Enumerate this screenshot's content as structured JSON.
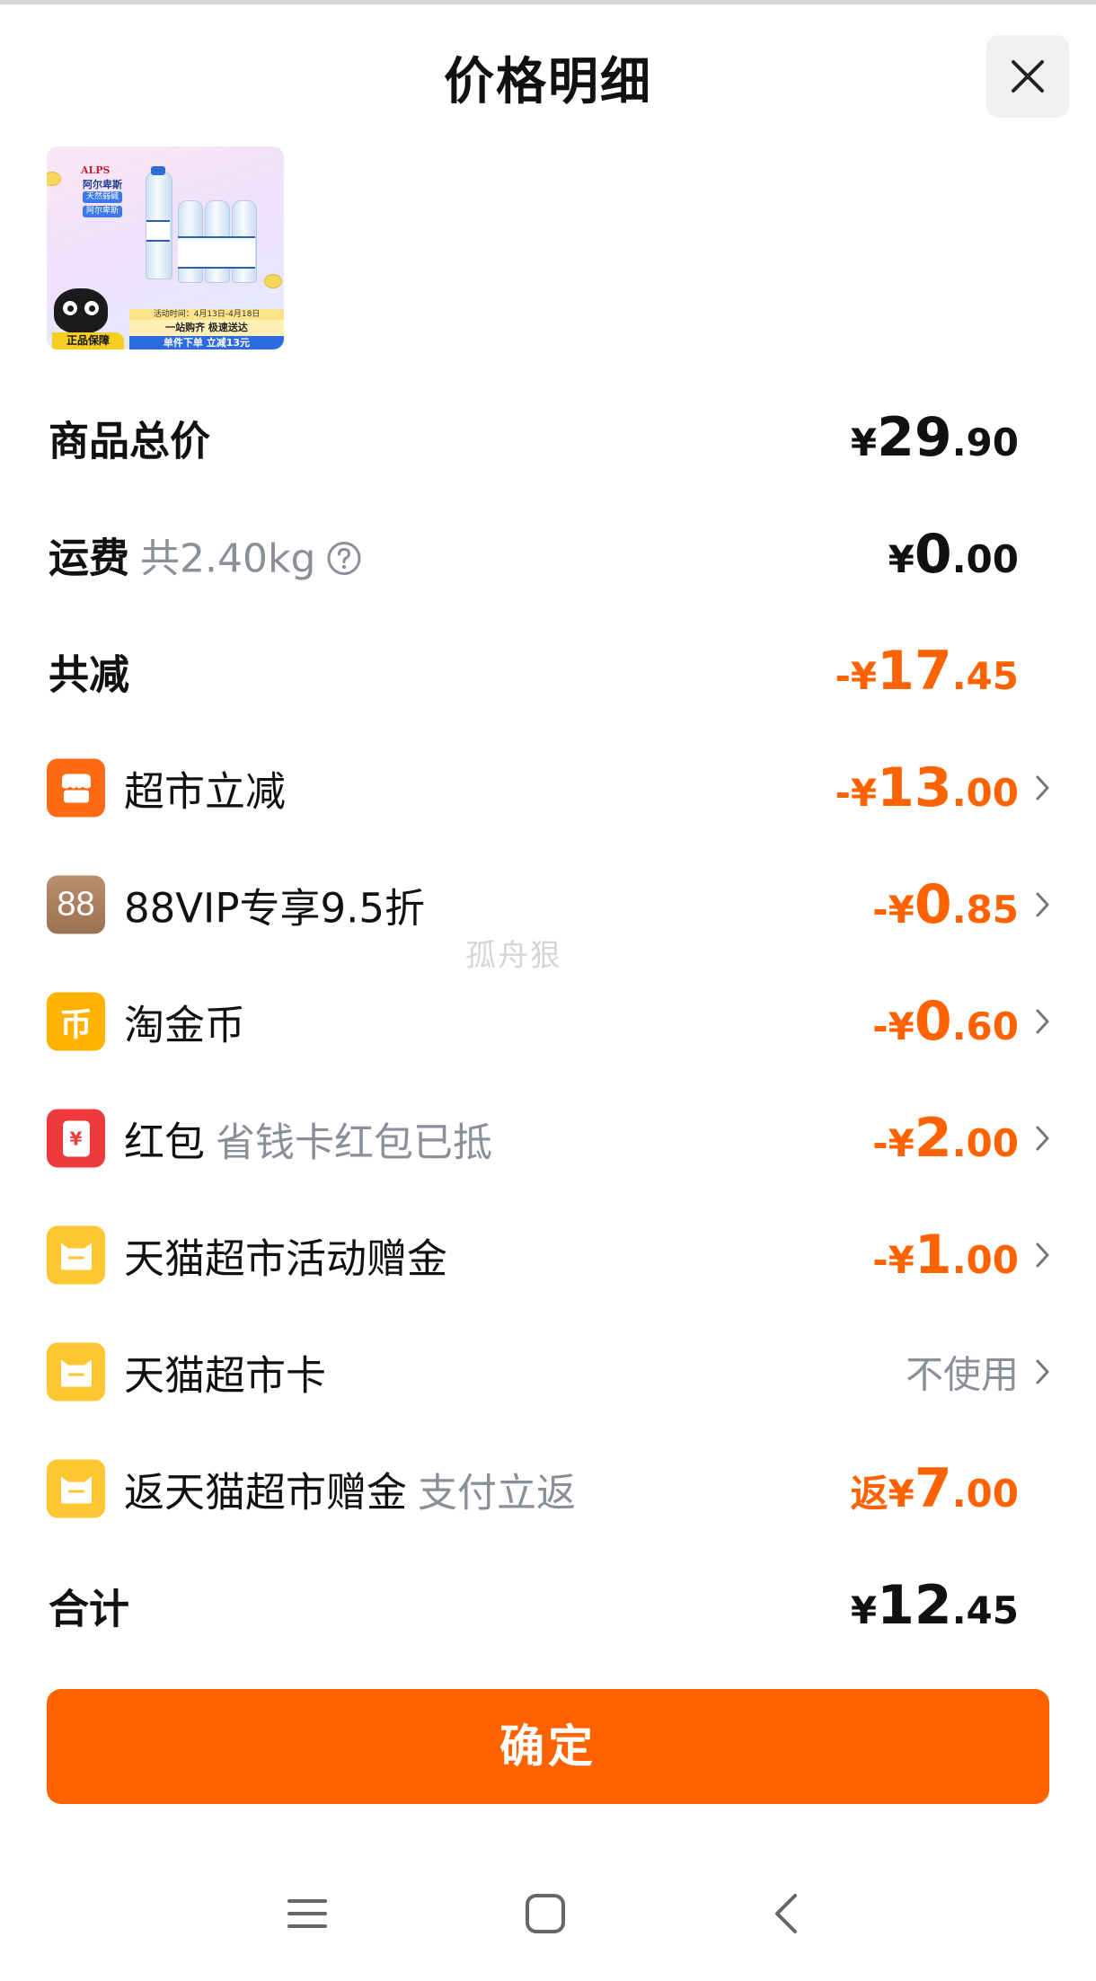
{
  "header": {
    "title": "价格明细"
  },
  "product": {
    "brand_latin": "ALPS",
    "brand_cn": "阿尔卑斯",
    "tags": [
      "天然弱碱",
      "阿尔卑斯"
    ],
    "promo_line1": "活动时间：4月13日-4月18日",
    "promo_line2": "一站购齐 极速送达",
    "promo_line3": "单件下单 立减13元",
    "guarantee": "正品保障"
  },
  "rows": {
    "goods_total": {
      "label": "商品总价",
      "sym": "¥",
      "int": "29",
      "dec": ".90"
    },
    "shipping": {
      "label": "运费",
      "sub": "共2.40kg",
      "sym": "¥",
      "int": "0",
      "dec": ".00"
    },
    "total_discount": {
      "label": "共减",
      "sym": "-¥",
      "int": "17",
      "dec": ".45"
    },
    "supermarket_off": {
      "label": "超市立减",
      "sym": "-¥",
      "int": "13",
      "dec": ".00"
    },
    "vip": {
      "icon_text": "88",
      "label": "88VIP专享9.5折",
      "sym": "-¥",
      "int": "0",
      "dec": ".85"
    },
    "taojinbi": {
      "icon_text": "币",
      "label": "淘金币",
      "sym": "-¥",
      "int": "0",
      "dec": ".60"
    },
    "red_packet": {
      "icon_text": "¥",
      "label": "红包",
      "sub": "省钱卡红包已抵",
      "sym": "-¥",
      "int": "2",
      "dec": ".00"
    },
    "activity_bonus": {
      "label": "天猫超市活动赠金",
      "sym": "-¥",
      "int": "1",
      "dec": ".00"
    },
    "tmall_card": {
      "label": "天猫超市卡",
      "value": "不使用"
    },
    "cashback": {
      "label": "返天猫超市赠金",
      "sub": "支付立返",
      "sym": "返¥",
      "int": "7",
      "dec": ".00"
    },
    "total": {
      "label": "合计",
      "sym": "¥",
      "int": "12",
      "dec": ".45"
    }
  },
  "watermark": "孤舟狠",
  "confirm_button": "确定",
  "colors": {
    "accent": "#ff6200",
    "muted": "#8a8f98",
    "vip_brown": "#a67d5d",
    "red": "#ee3a3a",
    "yellow": "#ffc634",
    "orange_icon": "#ff6a14",
    "coin_yellow": "#ffb300"
  }
}
